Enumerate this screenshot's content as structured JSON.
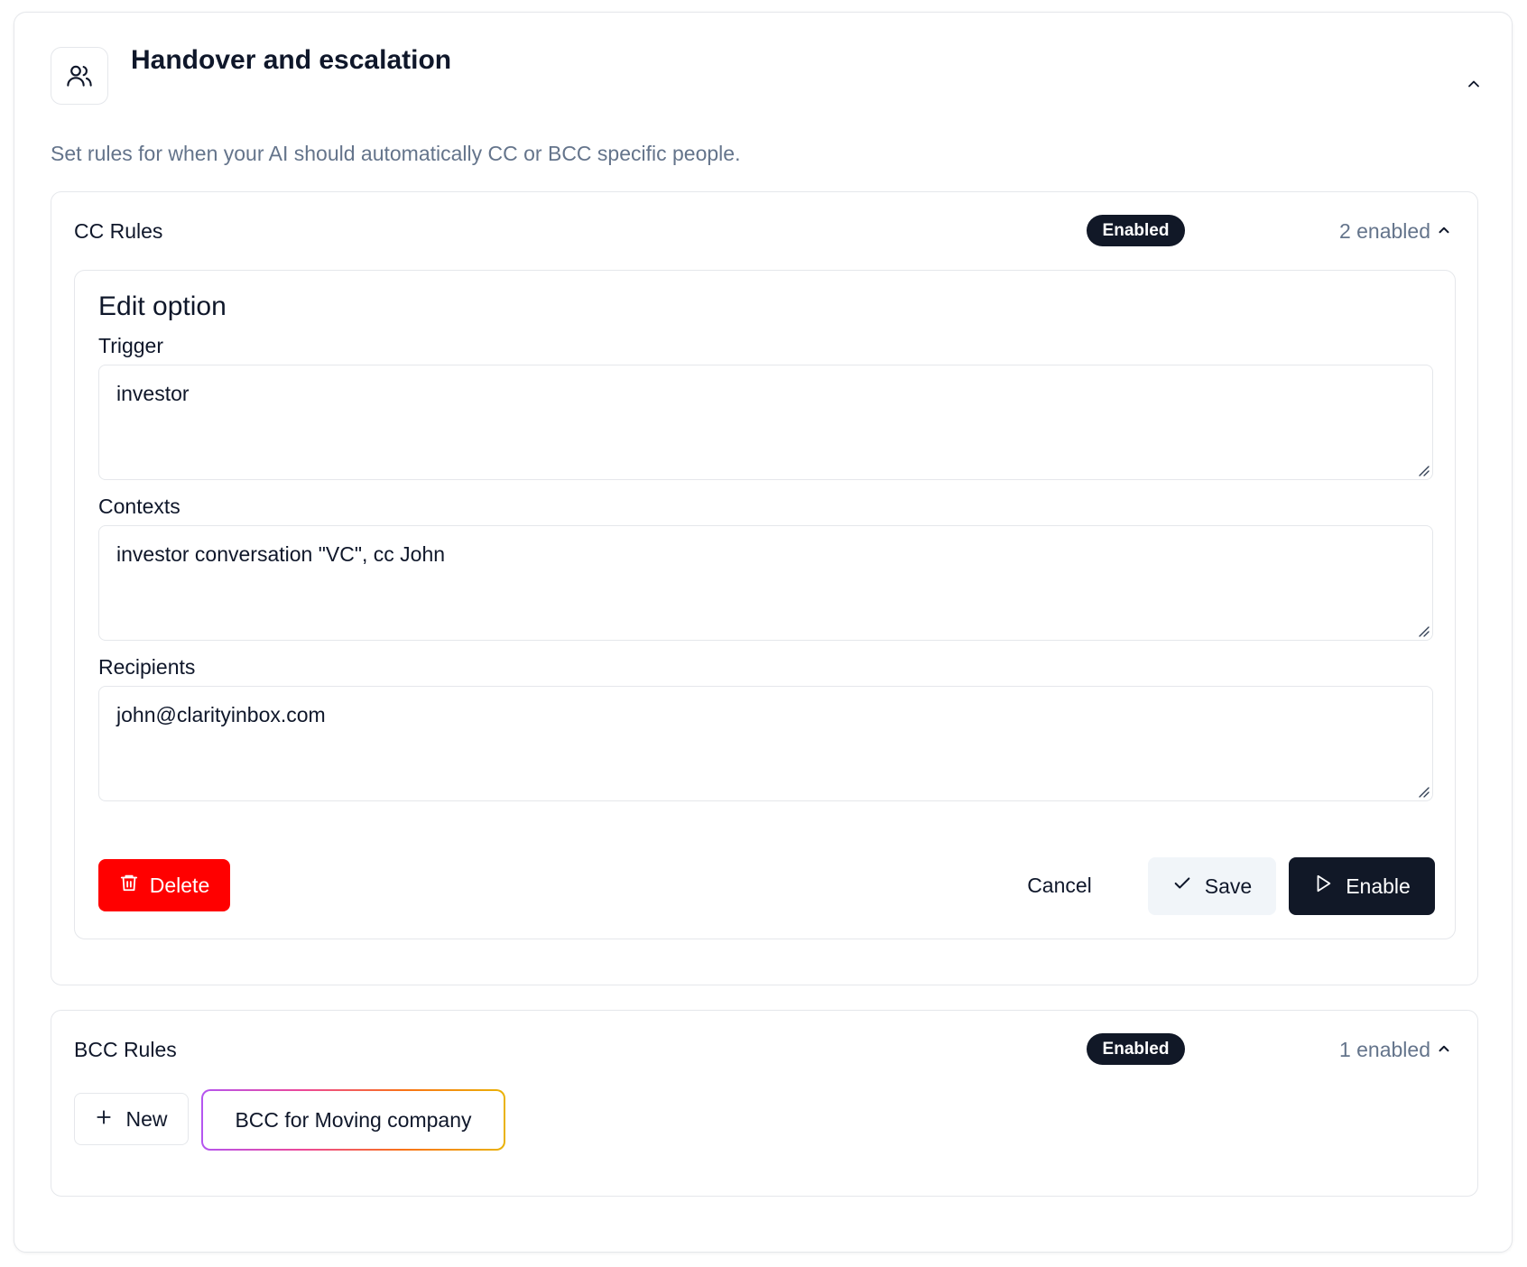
{
  "header": {
    "title": "Handover and escalation",
    "description": "Set rules for when your AI should automatically CC or BCC specific people.",
    "icon": "users-icon",
    "collapse_icon": "chevron-up-icon"
  },
  "cc_rules": {
    "title": "CC Rules",
    "badge": "Enabled",
    "count": "2 enabled",
    "edit": {
      "title": "Edit option",
      "trigger_label": "Trigger",
      "trigger_value": "investor",
      "contexts_label": "Contexts",
      "contexts_value": "investor conversation \"VC\", cc John",
      "recipients_label": "Recipients",
      "recipients_value": "john@clarityinbox.com",
      "delete_label": "Delete",
      "cancel_label": "Cancel",
      "save_label": "Save",
      "enable_label": "Enable"
    }
  },
  "bcc_rules": {
    "title": "BCC Rules",
    "badge": "Enabled",
    "count": "1 enabled",
    "new_label": "New",
    "items": [
      {
        "label": "BCC for Moving company"
      }
    ]
  },
  "colors": {
    "primary_dark": "#111827",
    "danger": "#ff0000",
    "muted_text": "#64748b",
    "border": "#e5e7eb"
  }
}
